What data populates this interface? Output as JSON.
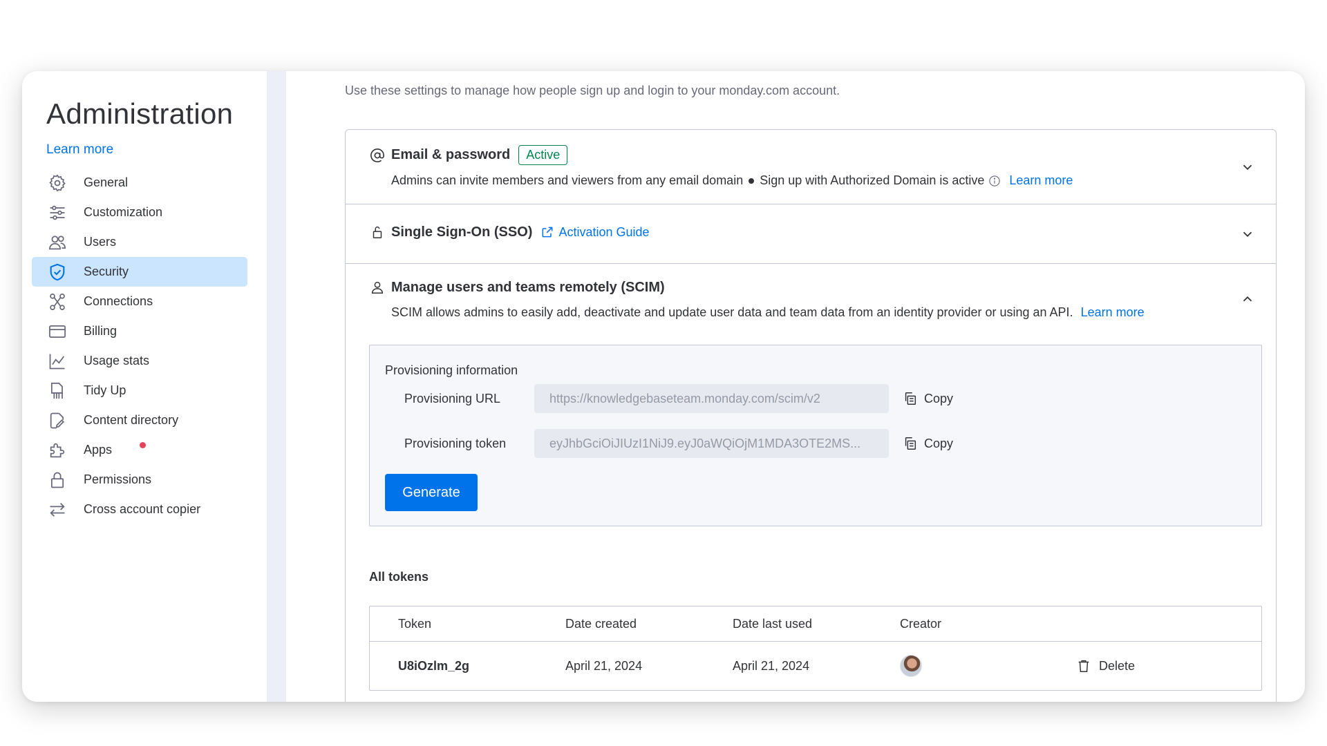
{
  "sidebar": {
    "title": "Administration",
    "learn_more": "Learn more",
    "items": [
      {
        "label": "General",
        "icon": "gear-icon"
      },
      {
        "label": "Customization",
        "icon": "sliders-icon"
      },
      {
        "label": "Users",
        "icon": "users-icon"
      },
      {
        "label": "Security",
        "icon": "shield-icon",
        "active": true
      },
      {
        "label": "Connections",
        "icon": "connections-icon"
      },
      {
        "label": "Billing",
        "icon": "credit-card-icon"
      },
      {
        "label": "Usage stats",
        "icon": "chart-line-icon"
      },
      {
        "label": "Tidy Up",
        "icon": "broom-icon"
      },
      {
        "label": "Content directory",
        "icon": "document-edit-icon"
      },
      {
        "label": "Apps",
        "icon": "puzzle-icon",
        "notification_dot": true
      },
      {
        "label": "Permissions",
        "icon": "lock-icon"
      },
      {
        "label": "Cross account copier",
        "icon": "arrows-swap-icon"
      }
    ]
  },
  "main": {
    "intro": "Use these settings to manage how people sign up and login to your monday.com account.",
    "email": {
      "title": "Email & password",
      "badge": "Active",
      "desc_part1": "Admins can invite members and viewers from any email domain",
      "desc_part2": "Sign up with Authorized Domain is active",
      "learn_more": "Learn more"
    },
    "sso": {
      "title": "Single Sign-On (SSO)",
      "guide": "Activation Guide"
    },
    "scim": {
      "title": "Manage users and teams remotely (SCIM)",
      "desc": "SCIM allows admins to easily add, deactivate and update user data and team data from an identity provider or using an API.",
      "learn_more": "Learn more"
    },
    "provisioning": {
      "title": "Provisioning information",
      "url_label": "Provisioning URL",
      "url_value": "https://knowledgebaseteam.monday.com/scim/v2",
      "token_label": "Provisioning token",
      "token_value": "eyJhbGciOiJIUzI1NiJ9.eyJ0aWQiOjM1MDA3OTE2MS...",
      "copy_label": "Copy",
      "generate_label": "Generate"
    },
    "tokens": {
      "title": "All tokens",
      "columns": [
        "Token",
        "Date created",
        "Date last used",
        "Creator"
      ],
      "rows": [
        {
          "token": "U8iOzlm_2g",
          "created": "April 21, 2024",
          "last_used": "April 21, 2024",
          "delete_label": "Delete"
        }
      ]
    }
  },
  "colors": {
    "accent": "#0073ea",
    "active_nav": "#cce5ff",
    "success": "#00854d",
    "notification": "#e2445c"
  }
}
